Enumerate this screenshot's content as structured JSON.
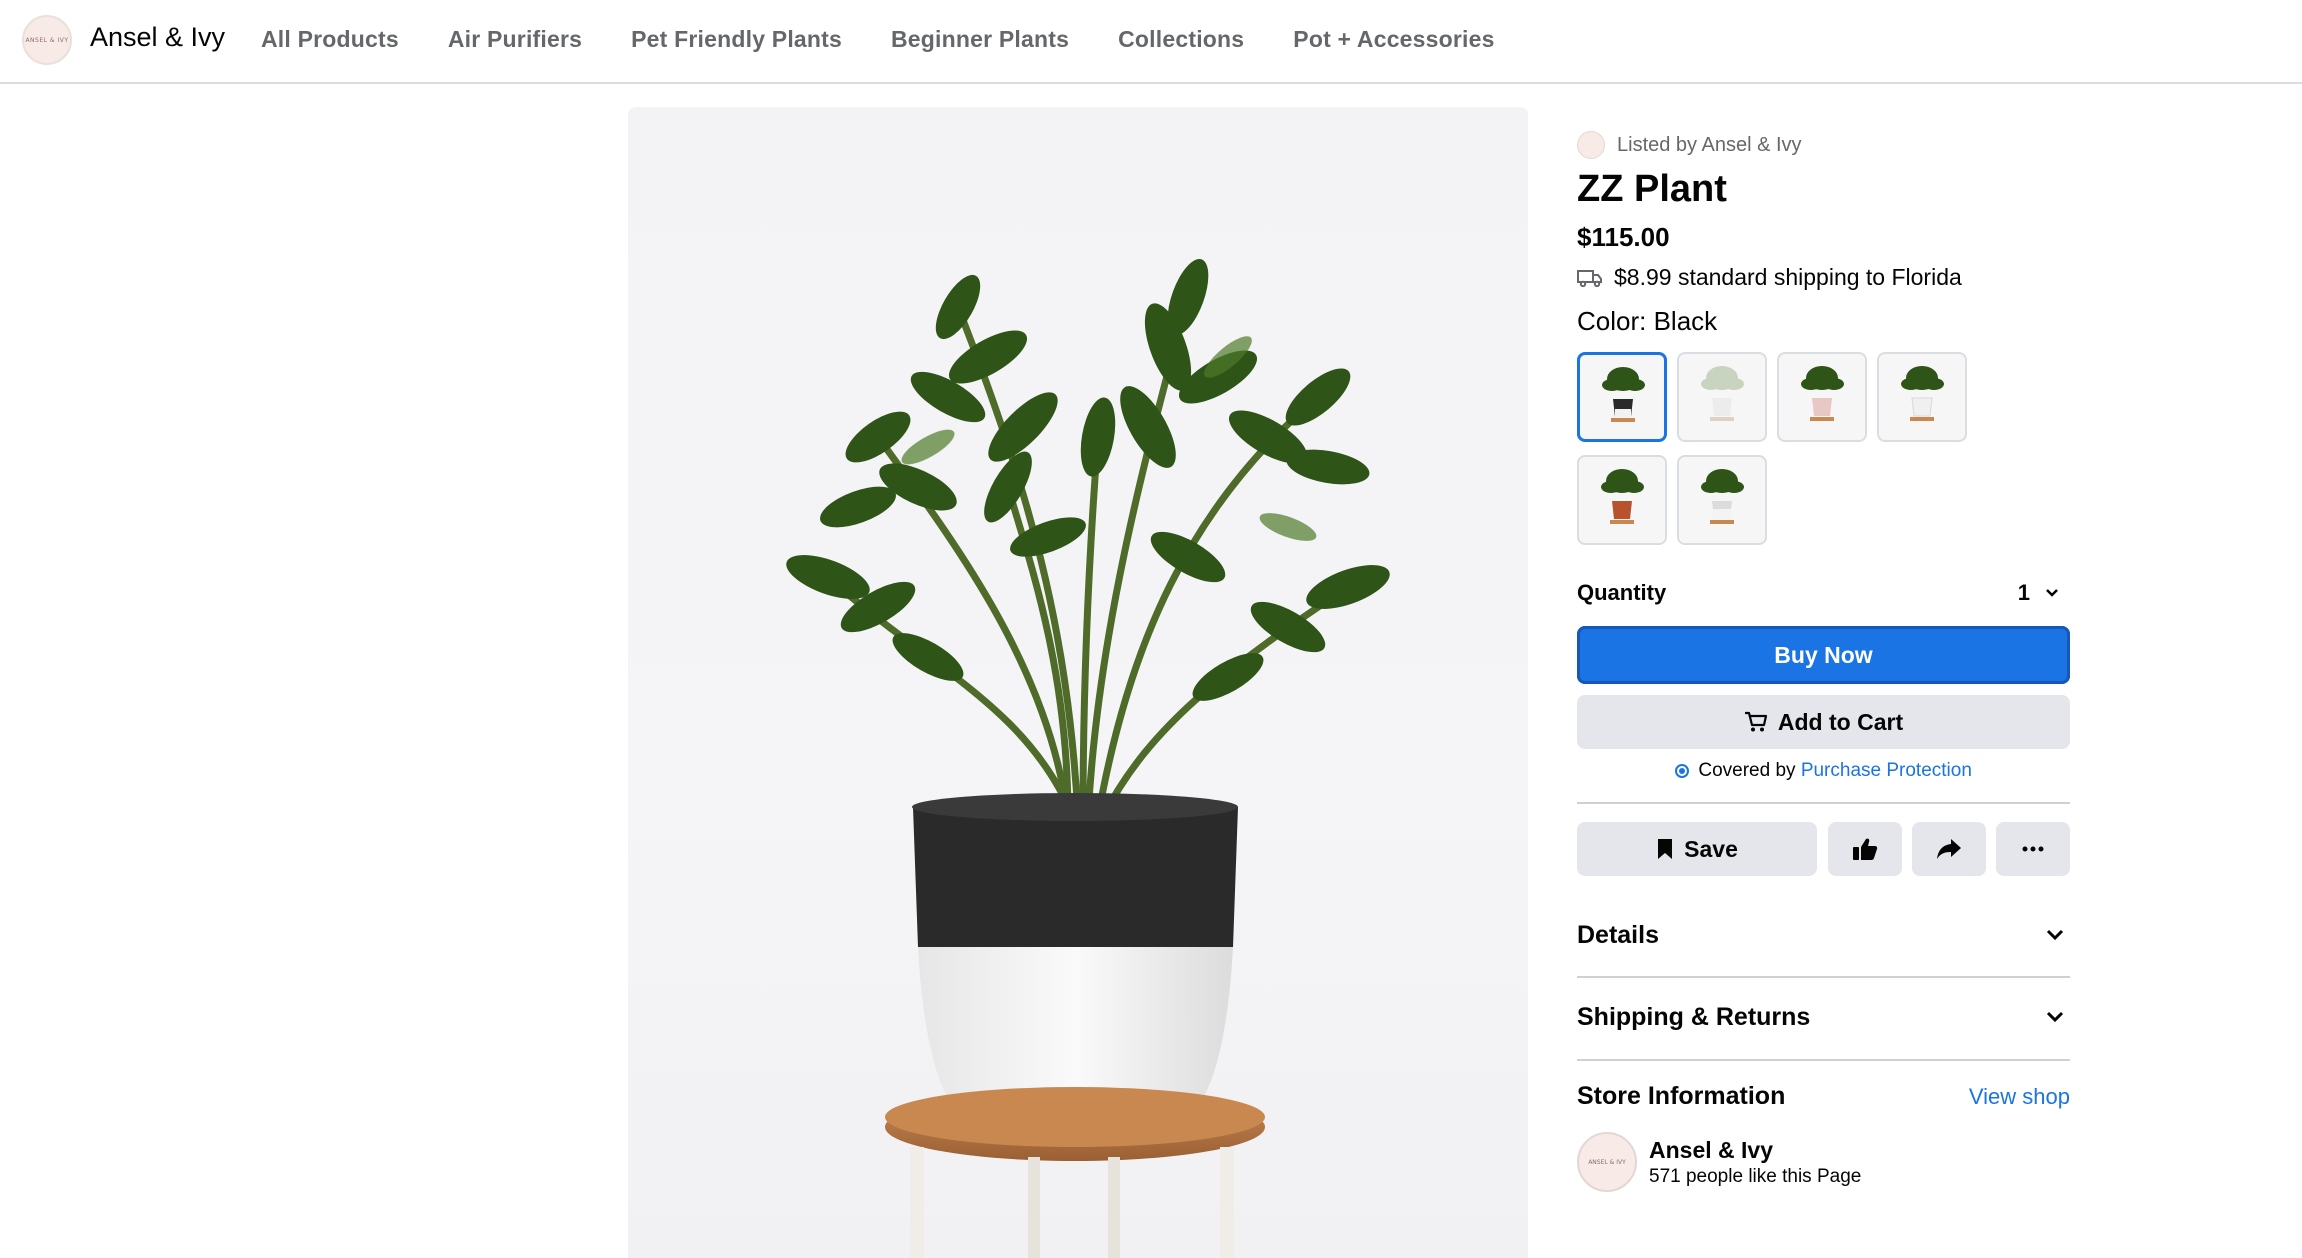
{
  "header": {
    "logo_text": "ANSEL & IVY",
    "store_name": "Ansel & Ivy",
    "nav": [
      "All Products",
      "Air Purifiers",
      "Pet Friendly Plants",
      "Beginner Plants",
      "Collections",
      "Pot + Accessories"
    ]
  },
  "product": {
    "listed_by": "Listed by Ansel & Ivy",
    "title": "ZZ Plant",
    "price": "$115.00",
    "shipping": "$8.99 standard shipping to Florida",
    "color_label": "Color: Black",
    "swatches": [
      {
        "name": "black",
        "pot": "#2a2a2a",
        "selected": true
      },
      {
        "name": "white-faded",
        "pot": "#e8e8e8",
        "selected": false
      },
      {
        "name": "blush",
        "pot": "#e8c8c4",
        "selected": false
      },
      {
        "name": "white",
        "pot": "#ececec",
        "selected": false
      },
      {
        "name": "terracotta",
        "pot": "#b8522c",
        "selected": false
      },
      {
        "name": "grey-white",
        "pot": "#dcdcdc",
        "selected": false
      }
    ],
    "quantity_label": "Quantity",
    "quantity_value": "1",
    "buy_now": "Buy Now",
    "add_to_cart": "Add to Cart",
    "protection_prefix": "Covered by",
    "protection_link": "Purchase Protection",
    "save": "Save"
  },
  "sections": {
    "details": "Details",
    "shipping_returns": "Shipping & Returns"
  },
  "store_info": {
    "title": "Store Information",
    "view_shop": "View shop",
    "avatar_text": "ANSEL & IVY",
    "name": "Ansel & Ivy",
    "likes": "571 people like this Page"
  },
  "colors": {
    "accent": "#1b74e4",
    "button_bg": "#e4e6eb",
    "muted_text": "#65676b"
  }
}
